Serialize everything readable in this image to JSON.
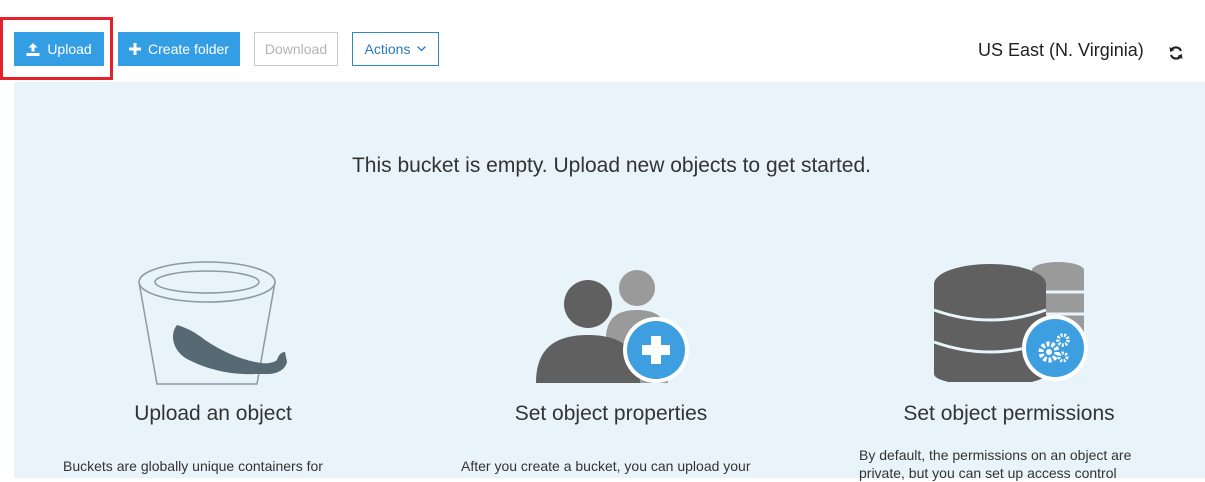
{
  "toolbar": {
    "upload_label": "Upload",
    "create_folder_label": "Create folder",
    "download_label": "Download",
    "actions_label": "Actions"
  },
  "header": {
    "region": "US East (N. Virginia)"
  },
  "main": {
    "empty_message": "This bucket is empty. Upload new objects to get started.",
    "columns": [
      {
        "title": "Upload an object",
        "text": "Buckets are globally unique containers for",
        "icon": "bucket-icon"
      },
      {
        "title": "Set object properties",
        "text": "After you create a bucket, you can upload your",
        "icon": "users-add-icon"
      },
      {
        "title": "Set object permissions",
        "text": "By default, the permissions on an object are private, but you can set up access control",
        "icon": "database-settings-icon"
      }
    ]
  },
  "colors": {
    "primary": "#339ee3",
    "highlight": "#e4222b",
    "panel_bg": "#e8f4fa",
    "illustration_gray": "#606060",
    "illustration_blue": "#3d9fdf"
  }
}
